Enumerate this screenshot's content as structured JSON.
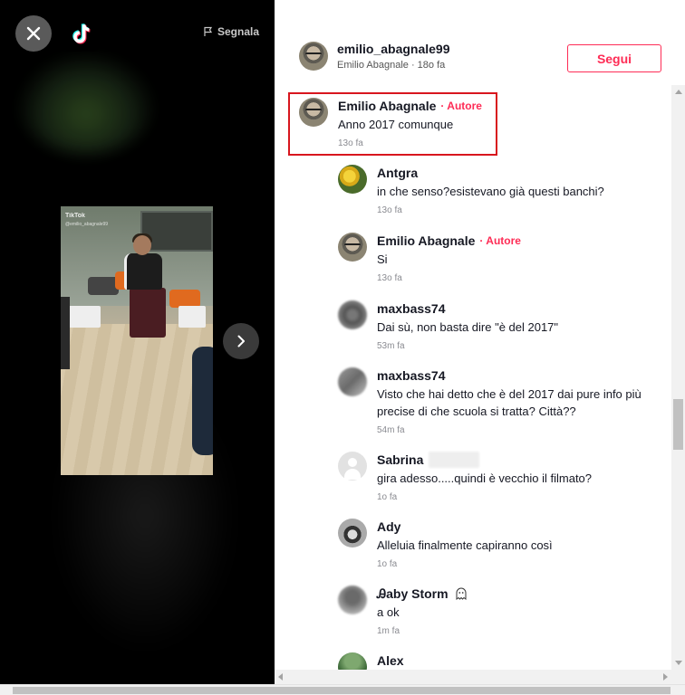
{
  "video_panel": {
    "report_label": "Segnala",
    "watermark_brand": "TikTok",
    "watermark_user": "@emilio_abagnale99",
    "icons": [
      "close-icon",
      "tiktok-logo-icon",
      "flag-icon",
      "chevron-right-icon"
    ]
  },
  "author": {
    "username": "emilio_abagnale99",
    "display_name": "Emilio Abagnale",
    "age": "18o fa",
    "subtitle": "Emilio Abagnale · 18o fa",
    "follow_label": "Segui"
  },
  "comments": [
    {
      "name": "Emilio Abagnale",
      "author_tag": "· Autore",
      "text": "Anno 2017 comunque",
      "time": "13o fa"
    },
    {
      "name": "Antgra",
      "author_tag": "",
      "text": "in che senso?esistevano già questi banchi?",
      "time": "13o fa"
    },
    {
      "name": "Emilio Abagnale",
      "author_tag": "· Autore",
      "text": "Si",
      "time": "13o fa"
    },
    {
      "name": "maxbass74",
      "author_tag": "",
      "text": "Dai sù, non basta dire \"è del 2017\"",
      "time": "53m fa"
    },
    {
      "name": "maxbass74",
      "author_tag": "",
      "text_line1": "Visto che hai detto che è del 2017 dai pure info più",
      "text_line2": "precise di che scuola si tratta? Città??",
      "time": "54m fa"
    },
    {
      "name": "Sabrina",
      "author_tag": "",
      "text": "gira adesso.....quindi è vecchio il filmato?",
      "time": "1o fa"
    },
    {
      "name": "Ady",
      "author_tag": "",
      "text": "Alleluia finalmente capiranno così",
      "time": "1o fa"
    },
    {
      "name": "Ꭿaby Storm",
      "author_tag": "",
      "text": "a ok",
      "time": "1m fa"
    },
    {
      "name": "Alex",
      "author_tag": "",
      "text": "",
      "time": ""
    }
  ],
  "colors": {
    "accent": "#fe2c55",
    "highlight_box": "#d8161e",
    "video_bg": "#000000"
  }
}
